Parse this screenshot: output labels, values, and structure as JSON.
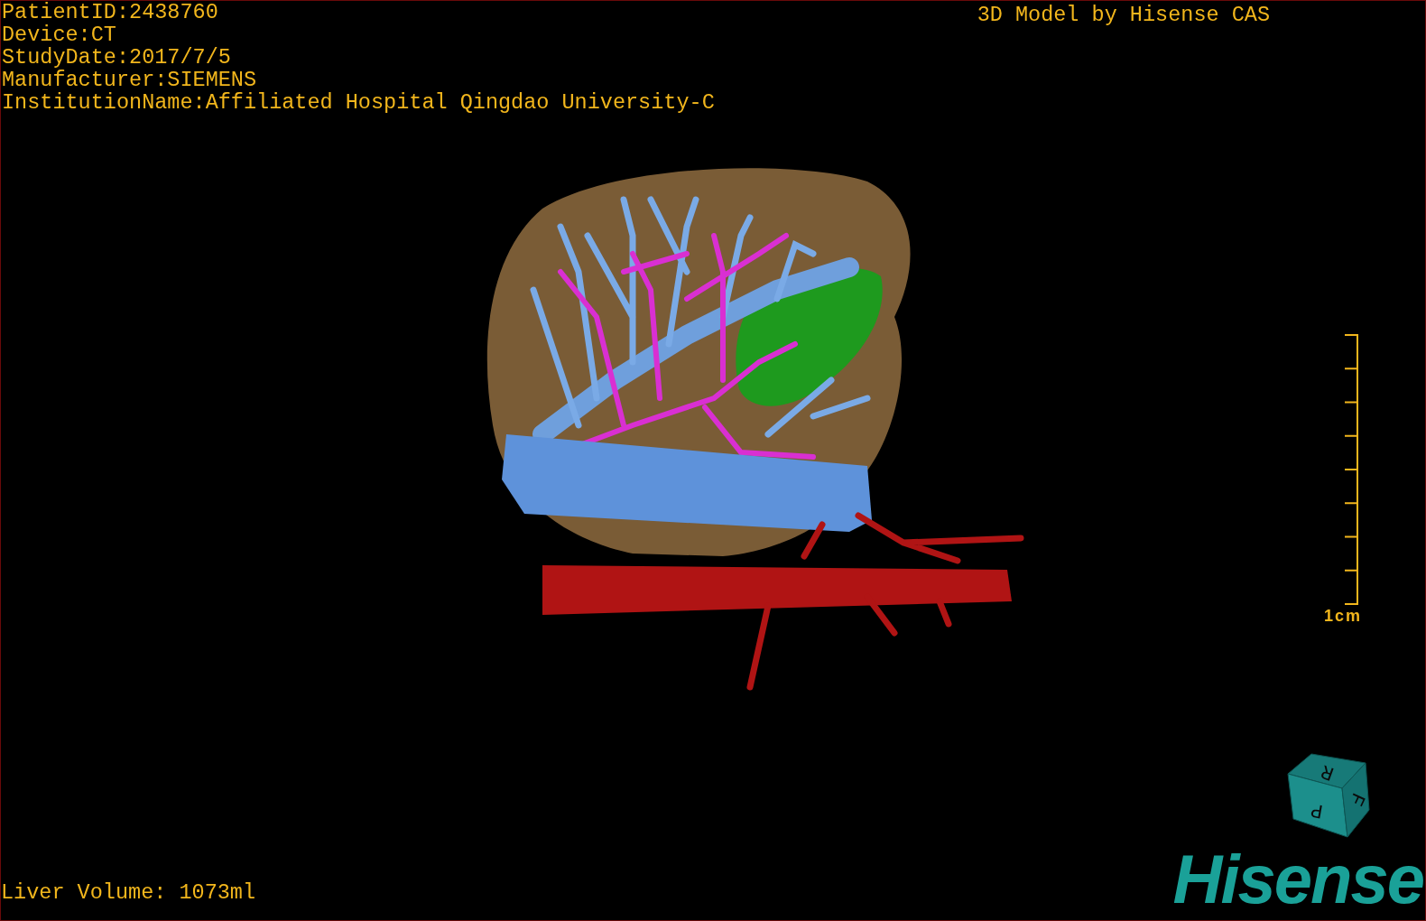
{
  "patient_info": [
    "PatientID:2438760",
    "Device:CT",
    "StudyDate:2017/7/5",
    "Manufacturer:SIEMENS",
    "InstitutionName:Affiliated Hospital Qingdao University-C"
  ],
  "viewer_title": "3D Model by Hisense CAS",
  "scale_bar": {
    "label": "1cm"
  },
  "liver_volume": "Liver Volume: 1073ml",
  "orientation_cube": {
    "faces": [
      {
        "kind": "top",
        "letter": "R"
      },
      {
        "kind": "front",
        "letter": "P"
      },
      {
        "kind": "side",
        "letter": "F"
      }
    ]
  },
  "logo": "Hisense"
}
